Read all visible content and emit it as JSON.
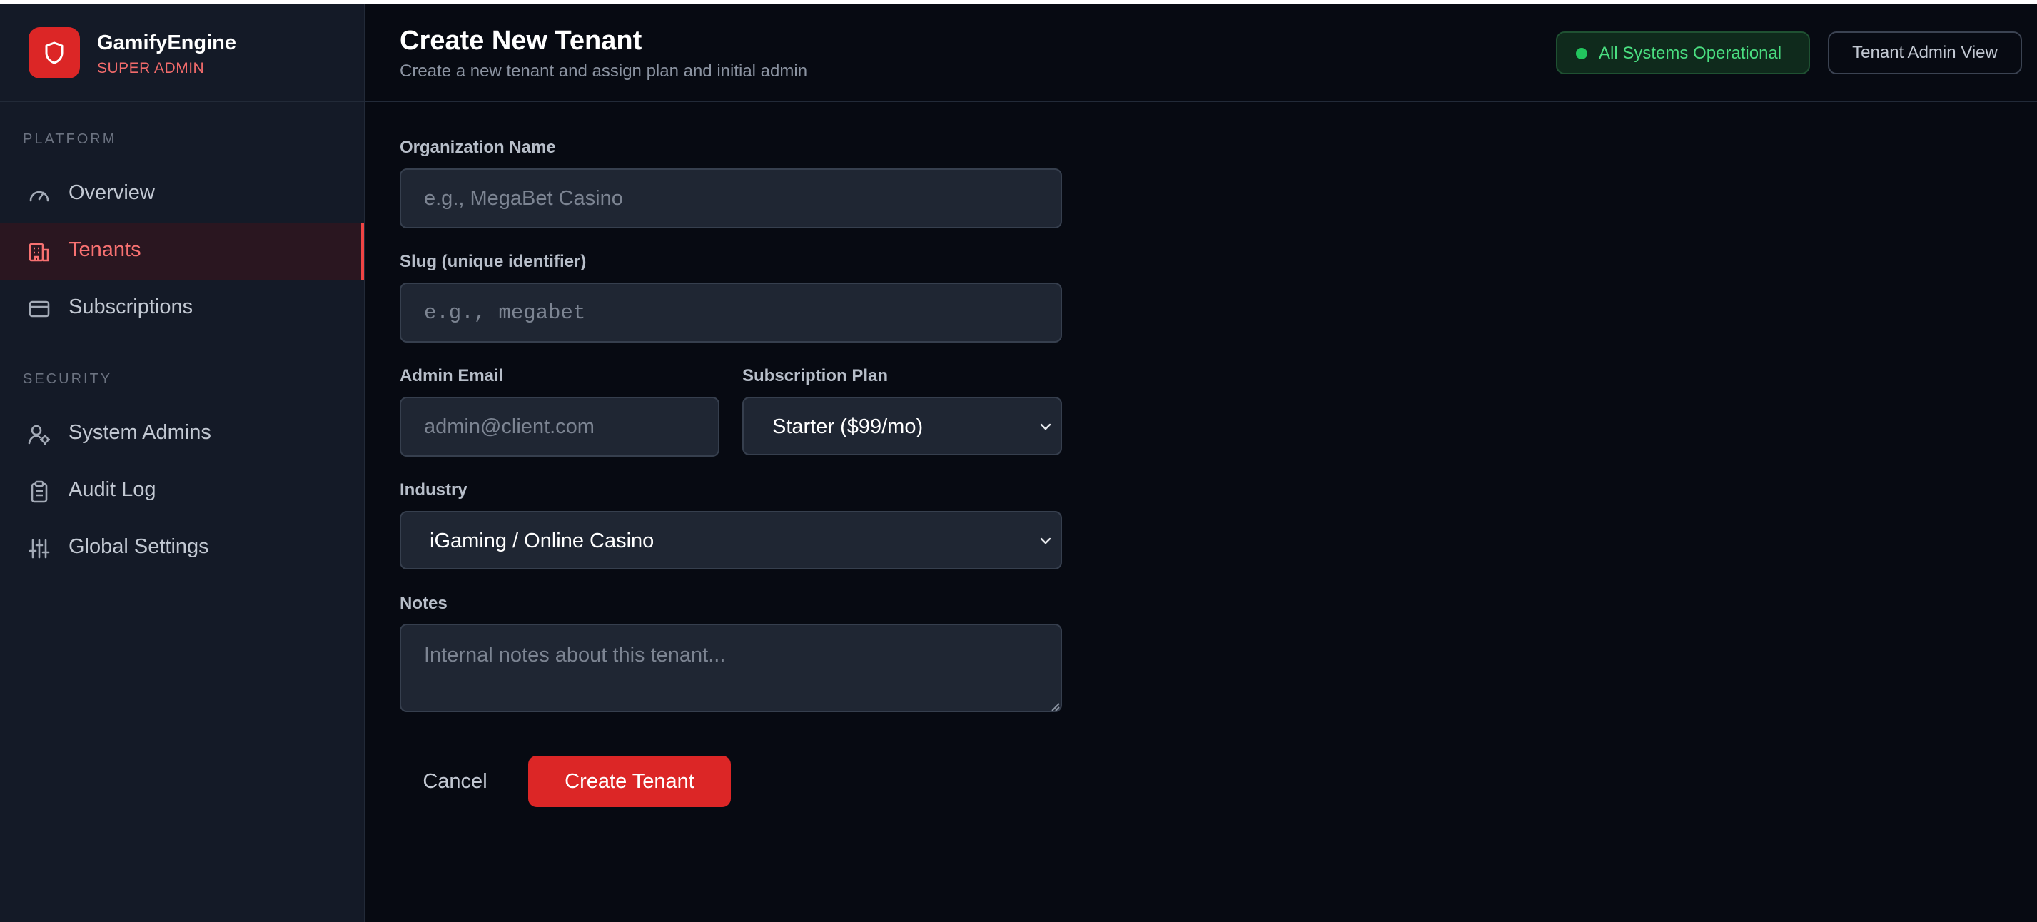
{
  "brand": {
    "name": "GamifyEngine",
    "role": "SUPER ADMIN"
  },
  "sidebar": {
    "sections": [
      {
        "label": "PLATFORM",
        "items": [
          {
            "label": "Overview",
            "icon": "gauge-icon"
          },
          {
            "label": "Tenants",
            "icon": "building-icon",
            "active": true
          },
          {
            "label": "Subscriptions",
            "icon": "credit-card-icon"
          }
        ]
      },
      {
        "label": "SECURITY",
        "items": [
          {
            "label": "System Admins",
            "icon": "user-cog-icon"
          },
          {
            "label": "Audit Log",
            "icon": "clipboard-icon"
          },
          {
            "label": "Global Settings",
            "icon": "sliders-icon"
          }
        ]
      }
    ]
  },
  "header": {
    "title": "Create New Tenant",
    "subtitle": "Create a new tenant and assign plan and initial admin",
    "status": "All Systems Operational",
    "view_button": "Tenant Admin View"
  },
  "form": {
    "org_name": {
      "label": "Organization Name",
      "placeholder": "e.g., MegaBet Casino"
    },
    "slug": {
      "label": "Slug (unique identifier)",
      "placeholder": "e.g., megabet"
    },
    "admin_email": {
      "label": "Admin Email",
      "placeholder": "admin@client.com"
    },
    "plan": {
      "label": "Subscription Plan",
      "value": "Starter ($99/mo)"
    },
    "industry": {
      "label": "Industry",
      "value": "iGaming / Online Casino"
    },
    "notes": {
      "label": "Notes",
      "placeholder": "Internal notes about this tenant..."
    },
    "cancel_label": "Cancel",
    "submit_label": "Create Tenant"
  },
  "colors": {
    "accent": "#dc2626",
    "success": "#22c55e",
    "background": "#070a12",
    "sidebar": "#141a27"
  }
}
